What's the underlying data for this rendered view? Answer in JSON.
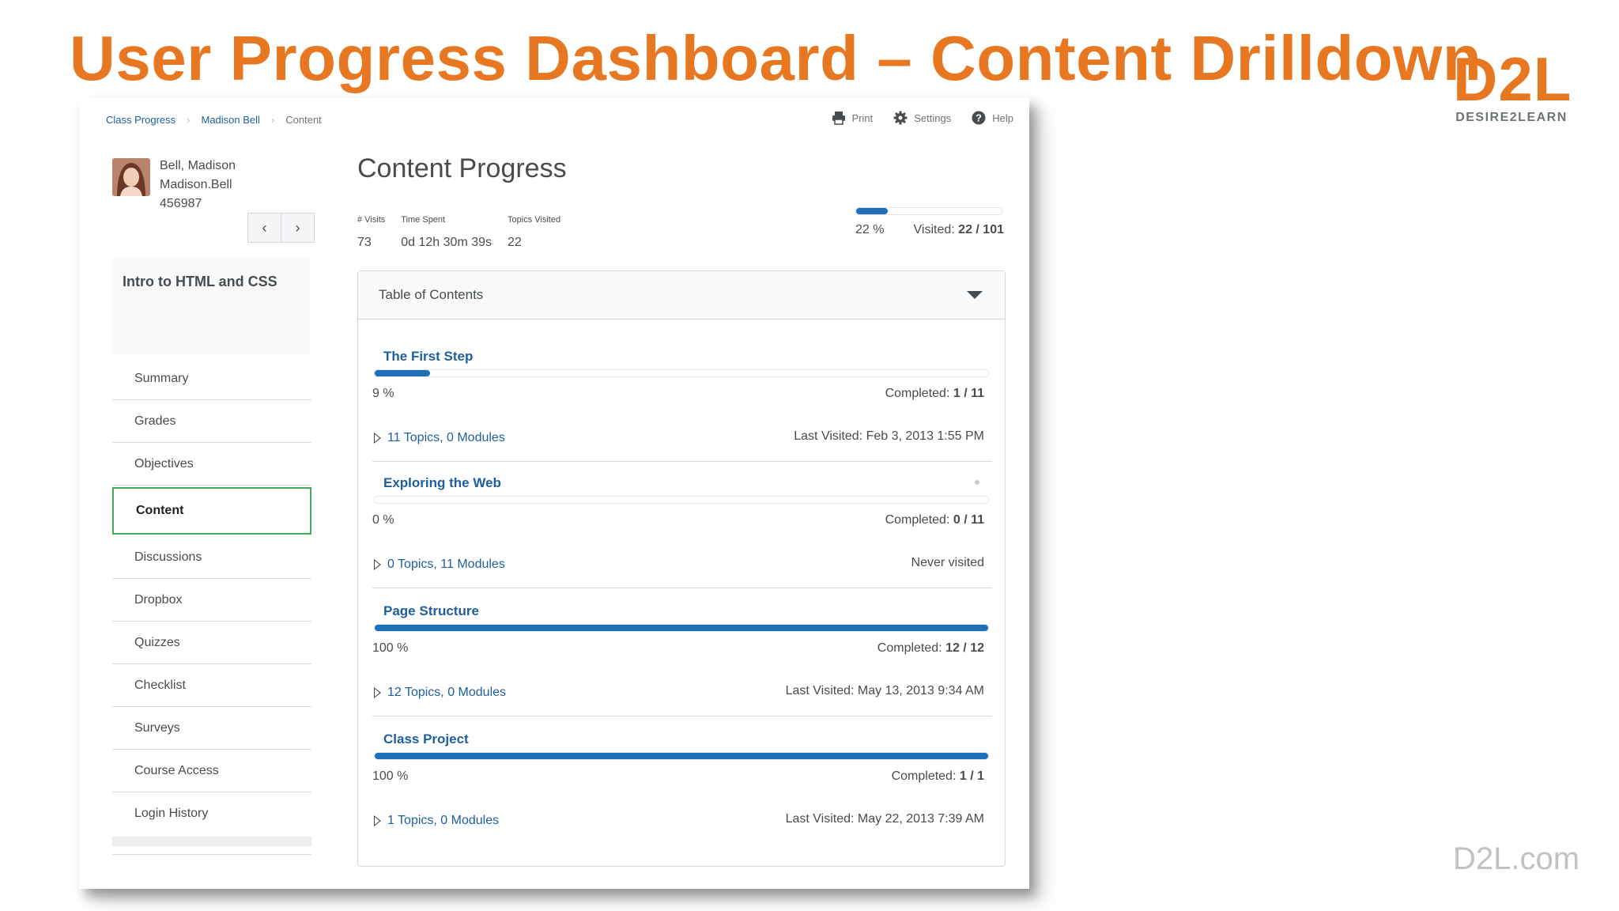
{
  "slide": {
    "title": "User Progress Dashboard – Content Drilldown",
    "logo_main": "D2L",
    "logo_sub": "DESIRE2LEARN",
    "footer_url": "D2L.com",
    "accent_color": "#e87722"
  },
  "breadcrumb": [
    "Class Progress",
    "Madison Bell",
    "Content"
  ],
  "toolbar": {
    "print_label": "Print",
    "print_icon": "printer-icon",
    "settings_label": "Settings",
    "settings_icon": "gear-icon",
    "help_label": "Help",
    "help_icon": "question-circle-icon"
  },
  "user": {
    "name": "Bell, Madison",
    "username": "Madison.Bell",
    "id": "456987",
    "prev_icon": "chevron-left-icon",
    "next_icon": "chevron-right-icon"
  },
  "course": {
    "name": "Intro to HTML and CSS"
  },
  "side_nav": {
    "items": [
      "Summary",
      "Grades",
      "Objectives",
      "Content",
      "Discussions",
      "Dropbox",
      "Quizzes",
      "Checklist",
      "Surveys",
      "Course Access",
      "Login History"
    ],
    "active": "Content",
    "active_color": "#3fae5a"
  },
  "main": {
    "title": "Content Progress",
    "stats": [
      {
        "label": "# Visits",
        "value": "73"
      },
      {
        "label": "Time Spent",
        "value": "0d 12h 30m 39s"
      },
      {
        "label": "Topics Visited",
        "value": "22"
      }
    ],
    "overall": {
      "percent_text": "22 %",
      "percent": 22,
      "visited_label": "Visited:",
      "visited_value": "22 / 101"
    },
    "toc_label": "Table of Contents",
    "toc_toggle_icon": "caret-down-icon",
    "bar_color": "#1d6fb8",
    "modules": [
      {
        "title": "The First Step",
        "percent": 9,
        "percent_text": "9 %",
        "completed_label": "Completed:",
        "completed": "1 / 11",
        "topics": "11 Topics, 0 Modules",
        "last_visited": "Last Visited: Feb 3, 2013 1:55 PM"
      },
      {
        "title": "Exploring the Web",
        "percent": 0,
        "percent_text": "0 %",
        "completed_label": "Completed:",
        "completed": "0 / 11",
        "topics": "0 Topics, 11 Modules",
        "last_visited": "Never visited"
      },
      {
        "title": "Page Structure",
        "percent": 100,
        "percent_text": "100 %",
        "completed_label": "Completed:",
        "completed": "12 / 12",
        "topics": "12 Topics, 0 Modules",
        "last_visited": "Last Visited: May 13, 2013 9:34 AM"
      },
      {
        "title": "Class Project",
        "percent": 100,
        "percent_text": "100 %",
        "completed_label": "Completed:",
        "completed": "1 / 1",
        "topics": "1 Topics, 0 Modules",
        "last_visited": "Last Visited: May 22, 2013 7:39 AM"
      }
    ]
  }
}
